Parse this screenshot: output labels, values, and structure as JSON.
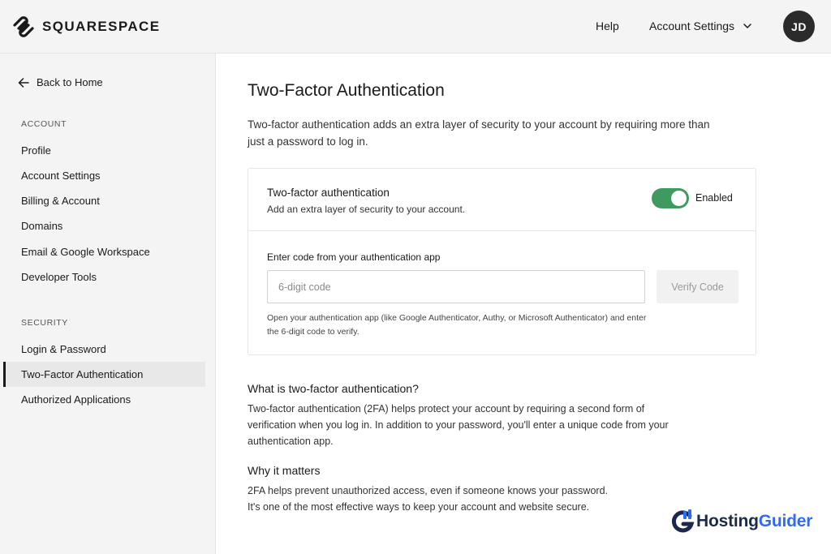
{
  "header": {
    "brand": "SQUARESPACE",
    "help_label": "Help",
    "account_label": "Account Settings",
    "avatar_initials": "JD"
  },
  "sidebar": {
    "back_label": "Back to Home",
    "account_section": "ACCOUNT",
    "account_items": [
      {
        "label": "Profile"
      },
      {
        "label": "Account Settings"
      },
      {
        "label": "Billing & Account"
      },
      {
        "label": "Domains"
      },
      {
        "label": "Email & Google Workspace"
      },
      {
        "label": "Developer Tools"
      }
    ],
    "security_section": "SECURITY",
    "security_items": [
      {
        "label": "Login & Password"
      },
      {
        "label": "Two-Factor Authentication",
        "active": true
      },
      {
        "label": "Authorized Applications"
      }
    ]
  },
  "main": {
    "title": "Two-Factor Authentication",
    "intro": "Two-factor authentication adds an extra layer of security to your account by requiring more than just a password to log in.",
    "card": {
      "title": "Two-factor authentication",
      "subtitle": "Add an extra layer of security to your account.",
      "toggle_state": "Enabled",
      "toggle_on": true,
      "code_label": "Enter code from your authentication app",
      "code_placeholder": "6-digit code",
      "code_value": "",
      "verify_label": "Verify Code",
      "help_text": "Open your authentication app (like Google Authenticator, Authy, or Microsoft Authenticator) and enter the 6-digit code to verify."
    },
    "what_title": "What is two-factor authentication?",
    "what_text": "Two-factor authentication (2FA) helps protect your account by requiring a second form of verification when you log in. In addition to your password, you'll enter a unique code from your authentication app.",
    "why_title": "Why it matters",
    "why_text_1": "2FA helps prevent unauthorized access, even if someone knows your password.",
    "why_text_2": "It's one of the most effective ways to keep your account and website secure."
  },
  "watermark": {
    "name_part1": "Hosting",
    "name_part2": "Guider",
    "icon": "hostingguider-logo-icon"
  },
  "colors": {
    "toggle_on": "#3f9a5f",
    "sidebar_bg": "#f4f4f4",
    "active_item_bg": "#e8e8e8",
    "avatar_bg": "#2b2b2b",
    "watermark_dark": "#1b2a4a",
    "watermark_accent": "#2f6df0"
  }
}
